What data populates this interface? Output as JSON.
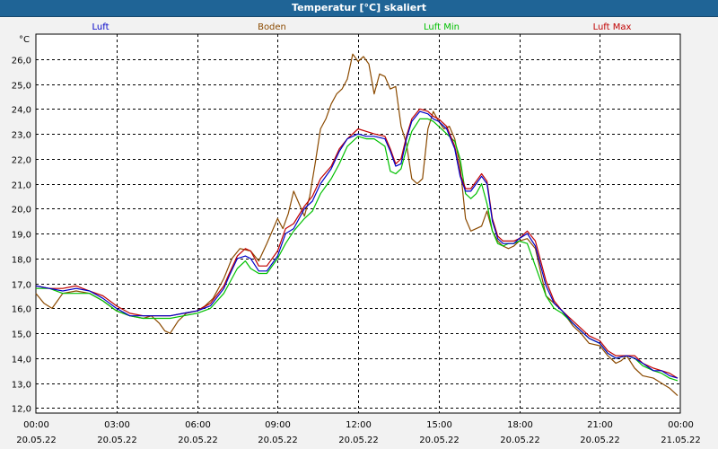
{
  "window": {
    "title": "Temperatur [°C] skaliert"
  },
  "colors": {
    "background": "#f2f2f2",
    "titlebar": "#1f6496",
    "plot_background": "#ffffff",
    "grid": "#000000"
  },
  "chart_data": {
    "type": "line",
    "title": "Temperatur [°C] skaliert",
    "ylabel": "°C",
    "xlabel": "",
    "grid": true,
    "grid_style": "dashed",
    "legend_placement": "top",
    "xlim": [
      0,
      24
    ],
    "ylim": [
      11.8,
      27.0
    ],
    "yticks": [
      12.0,
      13.0,
      14.0,
      15.0,
      16.0,
      17.0,
      18.0,
      19.0,
      20.0,
      21.0,
      22.0,
      23.0,
      24.0,
      25.0,
      26.0
    ],
    "yticklabels": [
      "12,0",
      "13,0",
      "14,0",
      "15,0",
      "16,0",
      "17,0",
      "18,0",
      "19,0",
      "20,0",
      "21,0",
      "22,0",
      "23,0",
      "24,0",
      "25,0",
      "26,0"
    ],
    "xticks": [
      {
        "x": 0,
        "time": "00:00",
        "date": "20.05.22"
      },
      {
        "x": 3,
        "time": "03:00",
        "date": "20.05.22"
      },
      {
        "x": 6,
        "time": "06:00",
        "date": "20.05.22"
      },
      {
        "x": 9,
        "time": "09:00",
        "date": "20.05.22"
      },
      {
        "x": 12,
        "time": "12:00",
        "date": "20.05.22"
      },
      {
        "x": 15,
        "time": "15:00",
        "date": "20.05.22"
      },
      {
        "x": 18,
        "time": "18:00",
        "date": "20.05.22"
      },
      {
        "x": 21,
        "time": "21:00",
        "date": "20.05.22"
      },
      {
        "x": 24,
        "time": "00:00",
        "date": "21.05.22"
      }
    ],
    "series": [
      {
        "name": "Boden",
        "color": "#8b4a00",
        "x": [
          0,
          0.3,
          0.6,
          0.8,
          1,
          1.5,
          2,
          2.5,
          3,
          3.5,
          4,
          4.3,
          4.6,
          4.8,
          5,
          5.3,
          5.6,
          6,
          6.3,
          6.6,
          7,
          7.3,
          7.6,
          8,
          8.3,
          8.6,
          9,
          9.2,
          9.4,
          9.6,
          9.8,
          10,
          10.2,
          10.4,
          10.6,
          10.8,
          11,
          11.2,
          11.4,
          11.6,
          11.8,
          12,
          12.2,
          12.4,
          12.6,
          12.8,
          13,
          13.2,
          13.4,
          13.6,
          13.8,
          14,
          14.2,
          14.4,
          14.6,
          14.8,
          15,
          15.2,
          15.4,
          15.6,
          15.8,
          16,
          16.2,
          16.4,
          16.6,
          16.8,
          17,
          17.2,
          17.4,
          17.6,
          17.8,
          18,
          18.3,
          18.6,
          19,
          19.3,
          19.6,
          20,
          20.3,
          20.6,
          21,
          21.3,
          21.6,
          21.8,
          22,
          22.3,
          22.6,
          23,
          23.3,
          23.6,
          23.9
        ],
        "values": [
          16.6,
          16.2,
          16.0,
          16.3,
          16.6,
          16.7,
          16.6,
          16.3,
          15.9,
          15.7,
          15.6,
          15.7,
          15.4,
          15.1,
          15.0,
          15.5,
          15.8,
          15.9,
          16.1,
          16.4,
          17.2,
          18.0,
          18.4,
          18.3,
          17.9,
          18.6,
          19.6,
          19.2,
          19.8,
          20.7,
          20.2,
          19.7,
          20.5,
          21.8,
          23.2,
          23.6,
          24.2,
          24.6,
          24.8,
          25.2,
          26.2,
          25.9,
          26.1,
          25.8,
          24.6,
          25.4,
          25.3,
          24.8,
          24.9,
          23.3,
          22.6,
          21.2,
          21.0,
          21.2,
          23.2,
          23.9,
          23.5,
          23.2,
          23.3,
          22.8,
          21.7,
          19.6,
          19.1,
          19.2,
          19.3,
          19.9,
          19.1,
          18.7,
          18.5,
          18.4,
          18.5,
          18.7,
          18.8,
          18.4,
          16.5,
          16.2,
          15.9,
          15.3,
          15.0,
          14.6,
          14.5,
          14.1,
          13.8,
          13.9,
          14.1,
          13.6,
          13.3,
          13.2,
          13.0,
          12.8,
          12.5
        ]
      },
      {
        "name": "Luft Min",
        "color": "#00c000",
        "x": [
          0,
          0.5,
          1,
          1.5,
          2,
          2.5,
          3,
          3.5,
          4,
          4.5,
          5,
          5.5,
          6,
          6.5,
          7,
          7.2,
          7.5,
          7.8,
          8,
          8.3,
          8.6,
          9,
          9.3,
          9.6,
          10,
          10.3,
          10.6,
          11,
          11.3,
          11.6,
          12,
          12.3,
          12.6,
          13,
          13.2,
          13.4,
          13.6,
          13.8,
          14,
          14.3,
          14.6,
          14.8,
          15,
          15.3,
          15.6,
          15.8,
          16,
          16.2,
          16.4,
          16.6,
          16.8,
          17,
          17.2,
          17.4,
          17.6,
          17.8,
          18,
          18.3,
          18.6,
          19,
          19.3,
          19.6,
          20,
          20.3,
          20.6,
          21,
          21.3,
          21.6,
          22,
          22.3,
          22.6,
          23,
          23.3,
          23.6,
          23.9
        ],
        "values": [
          16.8,
          16.8,
          16.6,
          16.6,
          16.6,
          16.3,
          15.9,
          15.7,
          15.6,
          15.6,
          15.6,
          15.7,
          15.8,
          16.0,
          16.6,
          17.0,
          17.6,
          17.9,
          17.6,
          17.4,
          17.4,
          18.0,
          18.6,
          19.1,
          19.6,
          19.9,
          20.6,
          21.2,
          21.8,
          22.5,
          22.9,
          22.8,
          22.8,
          22.5,
          21.5,
          21.4,
          21.6,
          22.4,
          23.1,
          23.6,
          23.6,
          23.5,
          23.3,
          23.0,
          22.7,
          22.0,
          20.6,
          20.4,
          20.6,
          21.0,
          20.2,
          19.1,
          18.6,
          18.5,
          18.6,
          18.6,
          18.7,
          18.6,
          17.7,
          16.5,
          16.0,
          15.8,
          15.4,
          15.1,
          14.8,
          14.6,
          14.2,
          14.0,
          14.1,
          14.0,
          13.7,
          13.5,
          13.4,
          13.2,
          13.1
        ]
      },
      {
        "name": "Luft Max",
        "color": "#c00000",
        "x": [
          0,
          0.5,
          1,
          1.5,
          2,
          2.5,
          3,
          3.5,
          4,
          4.5,
          5,
          5.5,
          6,
          6.5,
          7,
          7.2,
          7.5,
          7.8,
          8,
          8.3,
          8.6,
          9,
          9.3,
          9.6,
          10,
          10.3,
          10.6,
          11,
          11.3,
          11.6,
          12,
          12.3,
          12.6,
          13,
          13.2,
          13.4,
          13.6,
          13.8,
          14,
          14.3,
          14.6,
          14.8,
          15,
          15.3,
          15.6,
          15.8,
          16,
          16.2,
          16.4,
          16.6,
          16.8,
          17,
          17.2,
          17.4,
          17.6,
          17.8,
          18,
          18.3,
          18.6,
          19,
          19.3,
          19.6,
          20,
          20.3,
          20.6,
          21,
          21.3,
          21.6,
          22,
          22.3,
          22.6,
          23,
          23.3,
          23.6,
          23.9
        ],
        "values": [
          16.9,
          16.8,
          16.8,
          16.9,
          16.7,
          16.5,
          16.1,
          15.8,
          15.7,
          15.7,
          15.7,
          15.8,
          15.9,
          16.2,
          16.9,
          17.4,
          18.1,
          18.4,
          18.3,
          17.7,
          17.7,
          18.3,
          19.2,
          19.4,
          20.1,
          20.5,
          21.2,
          21.7,
          22.4,
          22.8,
          23.2,
          23.1,
          23.0,
          22.9,
          22.4,
          21.8,
          22.0,
          22.9,
          23.6,
          24.0,
          23.9,
          23.7,
          23.6,
          23.3,
          22.5,
          21.4,
          20.8,
          20.8,
          21.1,
          21.4,
          21.1,
          19.6,
          18.9,
          18.7,
          18.7,
          18.7,
          18.8,
          19.1,
          18.7,
          17.1,
          16.3,
          15.9,
          15.5,
          15.2,
          14.9,
          14.7,
          14.3,
          14.1,
          14.1,
          14.1,
          13.8,
          13.6,
          13.5,
          13.4,
          13.2
        ]
      },
      {
        "name": "Luft",
        "color": "#0000c8",
        "x": [
          0,
          0.5,
          1,
          1.5,
          2,
          2.5,
          3,
          3.5,
          4,
          4.5,
          5,
          5.5,
          6,
          6.5,
          7,
          7.2,
          7.5,
          7.8,
          8,
          8.3,
          8.6,
          9,
          9.3,
          9.6,
          10,
          10.3,
          10.6,
          11,
          11.3,
          11.6,
          12,
          12.3,
          12.6,
          13,
          13.2,
          13.4,
          13.6,
          13.8,
          14,
          14.3,
          14.6,
          14.8,
          15,
          15.3,
          15.6,
          15.8,
          16,
          16.2,
          16.4,
          16.6,
          16.8,
          17,
          17.2,
          17.4,
          17.6,
          17.8,
          18,
          18.3,
          18.6,
          19,
          19.3,
          19.6,
          20,
          20.3,
          20.6,
          21,
          21.3,
          21.6,
          22,
          22.3,
          22.6,
          23,
          23.3,
          23.6,
          23.9
        ],
        "values": [
          16.9,
          16.8,
          16.7,
          16.8,
          16.7,
          16.4,
          16.0,
          15.7,
          15.7,
          15.7,
          15.7,
          15.8,
          15.9,
          16.1,
          16.8,
          17.3,
          18.0,
          18.1,
          18.0,
          17.5,
          17.5,
          18.1,
          19.0,
          19.2,
          20.0,
          20.3,
          21.0,
          21.6,
          22.3,
          22.8,
          23.0,
          22.9,
          22.9,
          22.8,
          22.3,
          21.7,
          21.8,
          22.8,
          23.5,
          23.9,
          23.8,
          23.6,
          23.5,
          23.2,
          22.4,
          21.3,
          20.7,
          20.7,
          21.0,
          21.3,
          21.0,
          19.5,
          18.8,
          18.6,
          18.6,
          18.6,
          18.8,
          19.0,
          18.5,
          16.9,
          16.2,
          15.9,
          15.4,
          15.1,
          14.8,
          14.6,
          14.2,
          14.0,
          14.1,
          14.0,
          13.8,
          13.5,
          13.5,
          13.3,
          13.2
        ]
      }
    ]
  }
}
